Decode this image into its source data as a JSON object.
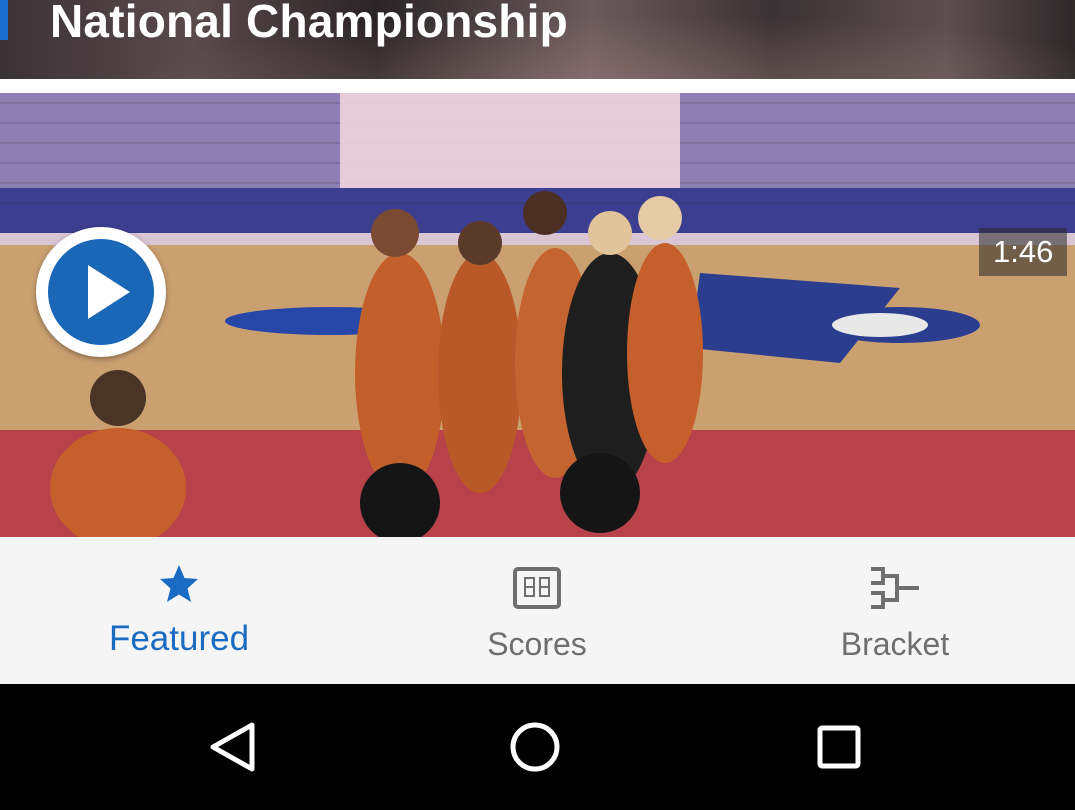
{
  "header": {
    "title": "National Championship"
  },
  "video": {
    "duration": "1:46"
  },
  "tabs": [
    {
      "label": "Featured",
      "icon": "star-icon",
      "active": true
    },
    {
      "label": "Scores",
      "icon": "scoreboard-icon",
      "active": false
    },
    {
      "label": "Bracket",
      "icon": "bracket-icon",
      "active": false
    }
  ],
  "navbar": {
    "buttons": [
      "back-icon",
      "home-icon",
      "recents-icon"
    ]
  },
  "colors": {
    "accent": "#1b6bc2",
    "play": "#1a67b8",
    "tab_inactive": "#6f6f6f",
    "tabbar_bg": "#f5f5f5"
  }
}
